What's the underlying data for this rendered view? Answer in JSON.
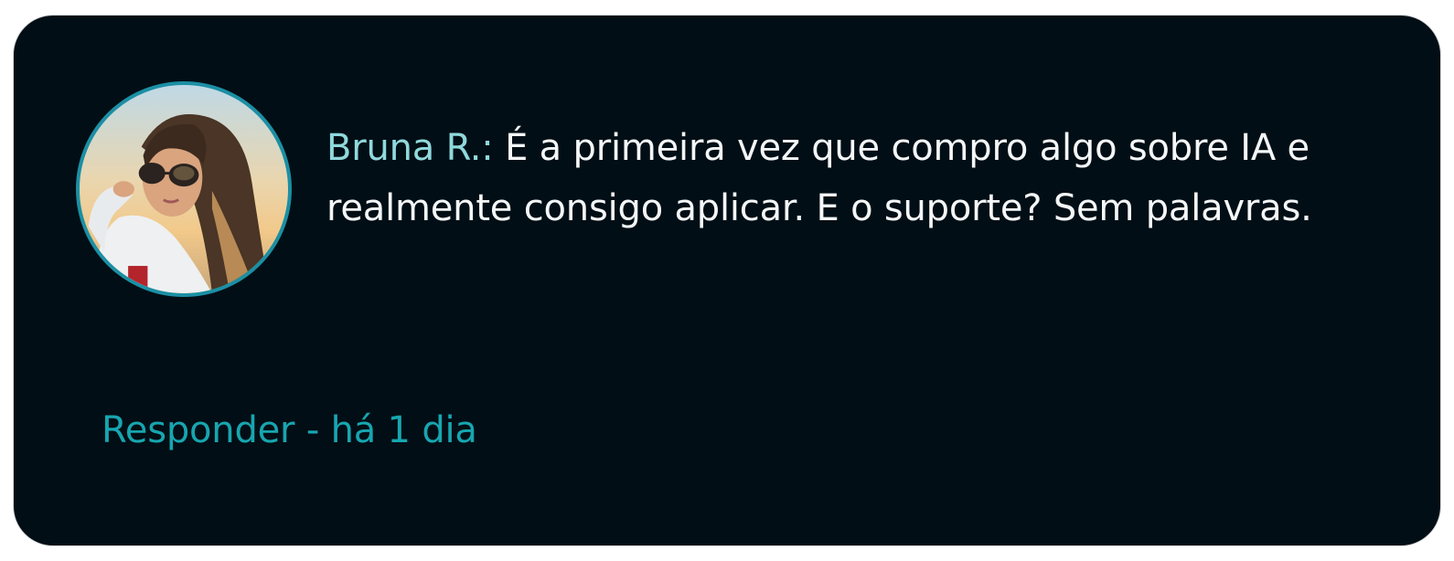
{
  "comment": {
    "author": "Bruna R.:",
    "text": "É a primeira vez que compro algo sobre IA e realmente consigo aplicar. E o suporte? Sem palavras."
  },
  "footer": {
    "reply_label": "Responder",
    "separator": " - ",
    "time": "há 1 dia"
  },
  "colors": {
    "card_background": "#020e15",
    "author": "#8fd9dc",
    "text": "#f4f7f8",
    "accent": "#17a6b0",
    "avatar_ring": "#1b8fa4"
  },
  "icons": {
    "avatar": "user-photo"
  }
}
